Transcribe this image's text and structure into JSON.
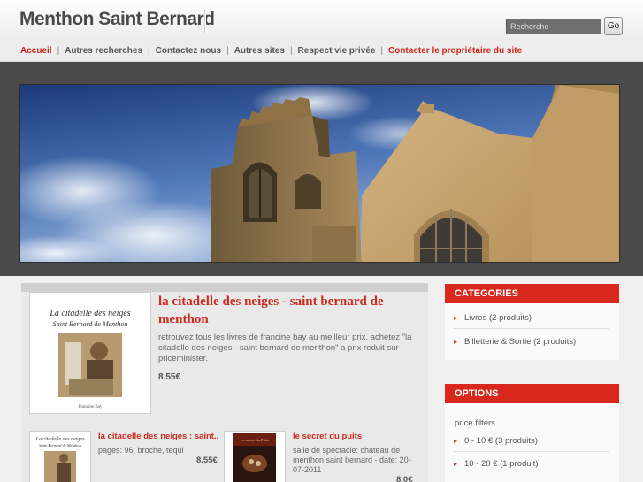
{
  "header": {
    "site_title": "Menthon Saint Bernard",
    "search_placeholder": "Recherche",
    "go_label": "Go"
  },
  "nav": {
    "items": [
      {
        "label": "Accueil",
        "highlight": true
      },
      {
        "label": "Autres recherches",
        "highlight": false
      },
      {
        "label": "Contactez nous",
        "highlight": false
      },
      {
        "label": "Autres sites",
        "highlight": false
      },
      {
        "label": "Respect vie privée",
        "highlight": false
      },
      {
        "label": "Contacter le propriétaire du site",
        "highlight": true
      }
    ],
    "separator": "|"
  },
  "featured": {
    "title": "la citadelle des neiges - saint bernard de menthon",
    "description": "retrouvez tous les livres de francine bay au meilleur prix. achetez \"la citadelle des neiges - saint bernard de menthon\" a prix reduit sur priceminister.",
    "price": "8.55€",
    "cover_text": {
      "title": "La citadelle des neiges",
      "subtitle": "Saint Bernard de Menthon",
      "author": "Francine Bay"
    }
  },
  "cards": [
    {
      "title": "la citadelle des neiges : saint...",
      "description": "pages: 96, broche, tequi",
      "price": "8.55€"
    },
    {
      "title": "le secret du puits",
      "description": "salle de spectacle: chateau de menthon saint bernard - date: 20-07-2011",
      "price": "8.0€",
      "cover_text": "Le secret du Puits"
    }
  ],
  "sidebar": {
    "categories_heading": "CATEGORIES",
    "categories": [
      {
        "label": "Livres (2 produits)"
      },
      {
        "label": "Billetterie & Sortie (2 produits)"
      }
    ],
    "options_heading": "OPTIONS",
    "price_filters_label": "price filters",
    "price_filters": [
      {
        "label": "0 - 10 € (3 produits)"
      },
      {
        "label": "10 - 20 € (1 produit)"
      }
    ]
  },
  "colors": {
    "accent_red": "#d8281d",
    "link_red": "#cf2a1d",
    "banner_frame": "#4a4a4a"
  }
}
